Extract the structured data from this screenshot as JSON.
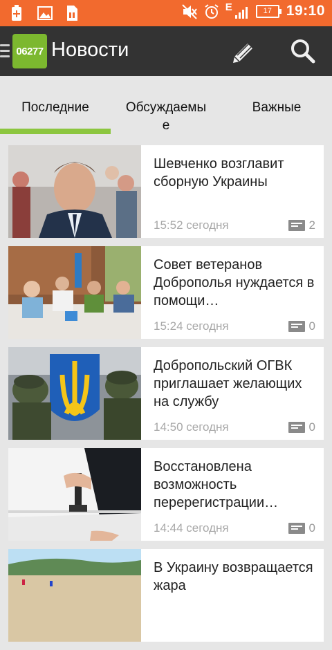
{
  "status_bar": {
    "time": "19:10",
    "battery": "17",
    "network": "E",
    "icons_left": [
      "notification-plus-icon",
      "image-icon",
      "sim-icon"
    ],
    "icons_right": [
      "mute-icon",
      "alarm-icon",
      "signal-icon",
      "battery-icon"
    ],
    "color": "#f26a2e"
  },
  "app_bar": {
    "logo_text": "06277",
    "title": "Новости",
    "actions": [
      "edit-icon",
      "search-icon"
    ],
    "color": "#333333",
    "accent": "#7cb82f"
  },
  "tabs": [
    {
      "label": "Последние",
      "selected": true
    },
    {
      "label": "Обсуждаемые",
      "selected": false
    },
    {
      "label": "Важные",
      "selected": false
    }
  ],
  "articles": [
    {
      "title": "Шевченко возглавит сборную Украины",
      "time": "15:52 сегодня",
      "comments": "2"
    },
    {
      "title": "Совет ветеранов Доброполья нуждается в помощи…",
      "time": "15:24 сегодня",
      "comments": "0"
    },
    {
      "title": "Добропольский ОГВК приглашает желающих на службу",
      "time": "14:50 сегодня",
      "comments": "0"
    },
    {
      "title": "Восстановлена возможность перерегистрации…",
      "time": "14:44 сегодня",
      "comments": "0"
    },
    {
      "title": "В Украину возвращается жара",
      "time": "",
      "comments": ""
    }
  ]
}
